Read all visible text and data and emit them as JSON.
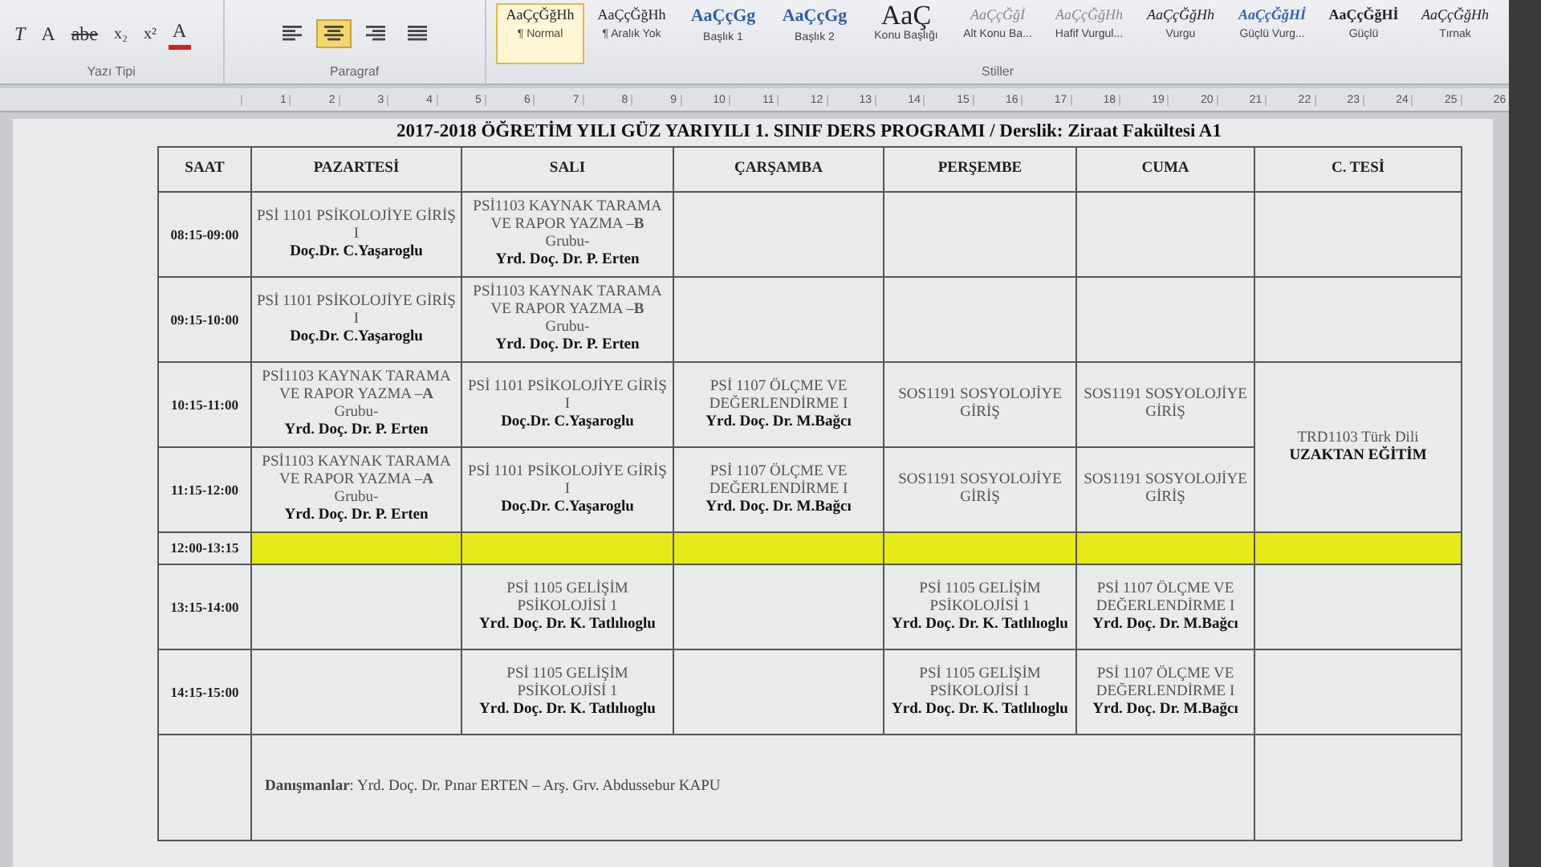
{
  "ribbon": {
    "font_tools": [
      {
        "label": "T",
        "kind": "italic"
      },
      {
        "label": "A",
        "kind": "plain"
      },
      {
        "label": "abe",
        "kind": "strike"
      },
      {
        "label": "x₂",
        "kind": "sub"
      },
      {
        "label": "x²",
        "kind": "sup"
      },
      {
        "label": "A",
        "kind": "color",
        "color": "#d02020"
      }
    ],
    "font_group": "Yazı Tipi",
    "paragraph_tools": [
      {
        "kind": "left",
        "selected": false
      },
      {
        "kind": "center",
        "selected": true
      },
      {
        "kind": "right",
        "selected": false
      },
      {
        "kind": "justify",
        "selected": false
      }
    ],
    "paragraph_group": "Paragraf",
    "styles": [
      {
        "preview": "AaÇçĞğHh",
        "name": "¶ Normal",
        "kind": "normal",
        "selected": true
      },
      {
        "preview": "AaÇçĞğHh",
        "name": "¶ Aralık Yok",
        "kind": "normal",
        "selected": false
      },
      {
        "preview": "AaÇçGg",
        "name": "Başlık 1",
        "kind": "heading",
        "selected": false
      },
      {
        "preview": "AaÇçGg",
        "name": "Başlık 2",
        "kind": "heading",
        "selected": false
      },
      {
        "preview": "AaÇ",
        "name": "Konu Başlığı",
        "kind": "title",
        "selected": false
      },
      {
        "preview": "AaÇçĞğİ",
        "name": "Alt Konu Ba...",
        "kind": "subtle",
        "selected": false
      },
      {
        "preview": "AaÇçĞğHh",
        "name": "Hafif Vurgul...",
        "kind": "subtle",
        "selected": false
      },
      {
        "preview": "AaÇçĞğHh",
        "name": "Vurgu",
        "kind": "emphasis",
        "selected": false
      },
      {
        "preview": "AaÇçĞğHİ",
        "name": "Güçlü Vurg...",
        "kind": "strong-blue",
        "selected": false
      },
      {
        "preview": "AaÇçĞğHİ",
        "name": "Güçlü",
        "kind": "strong",
        "selected": false
      },
      {
        "preview": "AaÇçĞğHh",
        "name": "Tırnak",
        "kind": "emphasis",
        "selected": false
      }
    ],
    "styles_group": "Stiller"
  },
  "ruler": [
    "1",
    "2",
    "3",
    "4",
    "5",
    "6",
    "7",
    "8",
    "9",
    "10",
    "11",
    "12",
    "13",
    "14",
    "15",
    "16",
    "17",
    "18",
    "19",
    "20",
    "21",
    "22",
    "23",
    "24",
    "25",
    "26"
  ],
  "document": {
    "title": "2017-2018 ÖĞRETİM YILI GÜZ YARIYILI 1. SINIF DERS PROGRAMI / Derslik: Ziraat Fakültesi A1",
    "columns": [
      "SAAT",
      "PAZARTESİ",
      "SALI",
      "ÇARŞAMBA",
      "PERŞEMBE",
      "CUMA",
      "C. TESİ"
    ],
    "rows": [
      {
        "cells": [
          {
            "kind": "time",
            "text": "08:15-09:00"
          },
          {
            "kind": "course",
            "course": "PSİ 1101 PSİKOLOJİYE GİRİŞ I",
            "lecturer": "Doç.Dr. C.Yaşaroglu"
          },
          {
            "kind": "course",
            "course": "PSİ1103 KAYNAK TARAMA VE RAPOR YAZMA –**B** Grubu-",
            "lecturer": "Yrd. Doç. Dr. P. Erten"
          },
          {
            "kind": "empty"
          },
          {
            "kind": "empty"
          },
          {
            "kind": "empty"
          },
          {
            "kind": "empty"
          }
        ]
      },
      {
        "cells": [
          {
            "kind": "time",
            "text": "09:15-10:00"
          },
          {
            "kind": "course",
            "course": "PSİ 1101 PSİKOLOJİYE GİRİŞ I",
            "lecturer": "Doç.Dr. C.Yaşaroglu"
          },
          {
            "kind": "course",
            "course": "PSİ1103 KAYNAK TARAMA VE RAPOR YAZMA –**B** Grubu-",
            "lecturer": "Yrd. Doç. Dr. P. Erten"
          },
          {
            "kind": "empty"
          },
          {
            "kind": "empty"
          },
          {
            "kind": "empty"
          },
          {
            "kind": "empty"
          }
        ]
      },
      {
        "cells": [
          {
            "kind": "time",
            "text": "10:15-11:00"
          },
          {
            "kind": "course",
            "course": "PSİ1103 KAYNAK TARAMA VE RAPOR YAZMA –**A** Grubu-",
            "lecturer": "Yrd. Doç. Dr. P. Erten"
          },
          {
            "kind": "course",
            "course": "PSİ 1101 PSİKOLOJİYE GİRİŞ I",
            "lecturer": "Doç.Dr. C.Yaşaroglu"
          },
          {
            "kind": "course",
            "course": "PSİ 1107 ÖLÇME VE DEĞERLENDİRME I",
            "lecturer": "Yrd. Doç. Dr. M.Bağcı"
          },
          {
            "kind": "course",
            "course": "SOS1191 SOSYOLOJİYE GİRİŞ"
          },
          {
            "kind": "course",
            "course": "SOS1191 SOSYOLOJİYE GİRİŞ"
          },
          {
            "kind": "course",
            "course": "TRD1103 Türk Dili",
            "lecturer": "UZAKTAN EĞİTİM",
            "spans_next_row": true
          }
        ]
      },
      {
        "cells": [
          {
            "kind": "time",
            "text": "11:15-12:00"
          },
          {
            "kind": "course",
            "course": "PSİ1103 KAYNAK TARAMA VE RAPOR YAZMA –**A** Grubu-",
            "lecturer": "Yrd. Doç. Dr. P. Erten"
          },
          {
            "kind": "course",
            "course": "PSİ 1101 PSİKOLOJİYE GİRİŞ I",
            "lecturer": "Doç.Dr. C.Yaşaroglu"
          },
          {
            "kind": "course",
            "course": "PSİ 1107 ÖLÇME VE DEĞERLENDİRME I",
            "lecturer": "Yrd. Doç. Dr. M.Bağcı"
          },
          {
            "kind": "course",
            "course": "SOS1191 SOSYOLOJİYE GİRİŞ"
          },
          {
            "kind": "course",
            "course": "SOS1191 SOSYOLOJİYE GİRİŞ"
          }
        ]
      },
      {
        "cells": [
          {
            "kind": "time",
            "text": "12:00-13:15"
          },
          {
            "kind": "lunch"
          },
          {
            "kind": "lunch"
          },
          {
            "kind": "lunch"
          },
          {
            "kind": "lunch"
          },
          {
            "kind": "lunch"
          },
          {
            "kind": "lunch"
          }
        ]
      },
      {
        "cells": [
          {
            "kind": "time",
            "text": "13:15-14:00"
          },
          {
            "kind": "empty"
          },
          {
            "kind": "course",
            "course": "PSİ 1105 GELİŞİM PSİKOLOJİSİ 1",
            "lecturer": "Yrd. Doç. Dr. K. Tatlılıoglu"
          },
          {
            "kind": "empty"
          },
          {
            "kind": "course",
            "course": "PSİ 1105 GELİŞİM PSİKOLOJİSİ 1",
            "lecturer": "Yrd. Doç. Dr. K. Tatlılıoglu"
          },
          {
            "kind": "course",
            "course": "PSİ 1107 ÖLÇME VE DEĞERLENDİRME I",
            "lecturer": "Yrd. Doç. Dr. M.Bağcı"
          },
          {
            "kind": "empty"
          }
        ]
      },
      {
        "cells": [
          {
            "kind": "time",
            "text": "14:15-15:00"
          },
          {
            "kind": "empty"
          },
          {
            "kind": "course",
            "course": "PSİ 1105 GELİŞİM PSİKOLOJİSİ 1",
            "lecturer": "Yrd. Doç. Dr. K. Tatlılıoglu"
          },
          {
            "kind": "empty"
          },
          {
            "kind": "course",
            "course": "PSİ 1105 GELİŞİM PSİKOLOJİSİ 1",
            "lecturer": "Yrd. Doç. Dr. K. Tatlılıoglu"
          },
          {
            "kind": "course",
            "course": "PSİ 1107 ÖLÇME VE DEĞERLENDİRME I",
            "lecturer": "Yrd. Doç. Dr. M.Bağcı"
          },
          {
            "kind": "empty"
          }
        ]
      }
    ],
    "advisors": "**Danışmanlar**:  Yrd. Doç. Dr. Pınar ERTEN – Arş. Grv. Abdussebur KAPU"
  }
}
